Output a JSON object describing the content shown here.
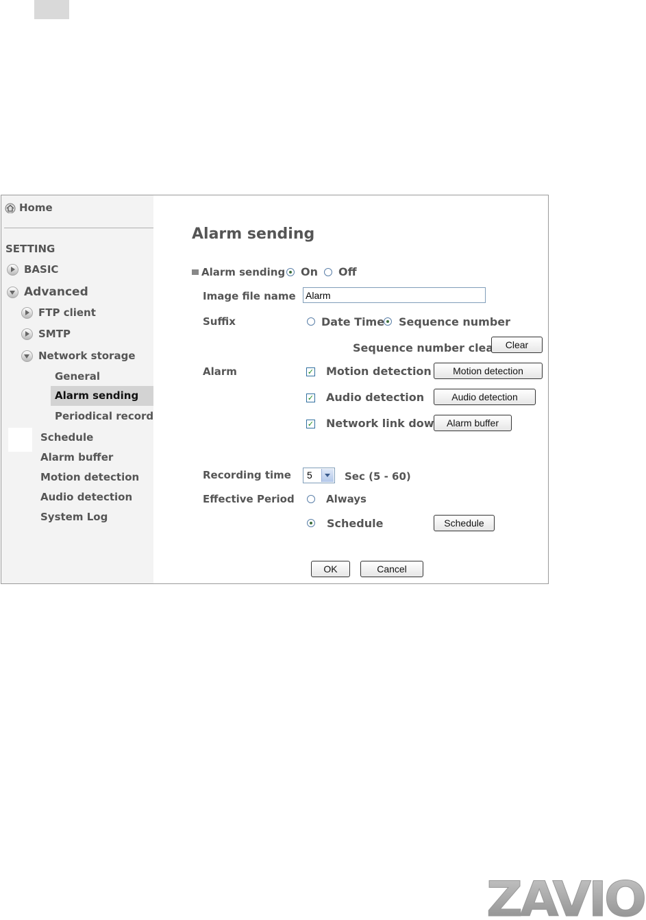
{
  "sidebar": {
    "home": "Home",
    "section": "SETTING",
    "basic": "BASIC",
    "advanced": "Advanced",
    "items": {
      "ftp": "FTP client",
      "smtp": "SMTP",
      "network_storage": "Network storage",
      "general": "General",
      "alarm_sending": "Alarm sending",
      "periodical": "Periodical recordir",
      "schedule": "Schedule",
      "alarm_buffer": "Alarm buffer",
      "motion": "Motion detection",
      "audio": "Audio detection",
      "syslog": "System Log"
    },
    "selected": "alarm_sending"
  },
  "main": {
    "title": "Alarm sending",
    "alarm_sending_label": "Alarm sending",
    "on_label": "On",
    "off_label": "Off",
    "alarm_sending_value": "On",
    "image_file_name_label": "Image file name",
    "image_file_name_value": "Alarm",
    "suffix_label": "Suffix",
    "suffix_date_time": "Date Time",
    "suffix_sequence": "Sequence number",
    "suffix_value": "Sequence number",
    "seq_clear_label": "Sequence number clear",
    "clear_button": "Clear",
    "alarm_label": "Alarm",
    "alarm_options": [
      {
        "label": "Motion detection",
        "checked": true,
        "button": "Motion detection"
      },
      {
        "label": "Audio detection",
        "checked": true,
        "button": "Audio detection"
      },
      {
        "label": "Network link down",
        "checked": true,
        "button": "Alarm buffer"
      }
    ],
    "recording_time_label": "Recording time",
    "recording_time_value": "5",
    "recording_time_unit": "Sec (5 - 60)",
    "effective_period_label": "Effective Period",
    "period_always": "Always",
    "period_schedule": "Schedule",
    "period_value": "Schedule",
    "schedule_button": "Schedule",
    "ok_button": "OK",
    "cancel_button": "Cancel"
  },
  "logo": {
    "text": "ZAVIO"
  }
}
